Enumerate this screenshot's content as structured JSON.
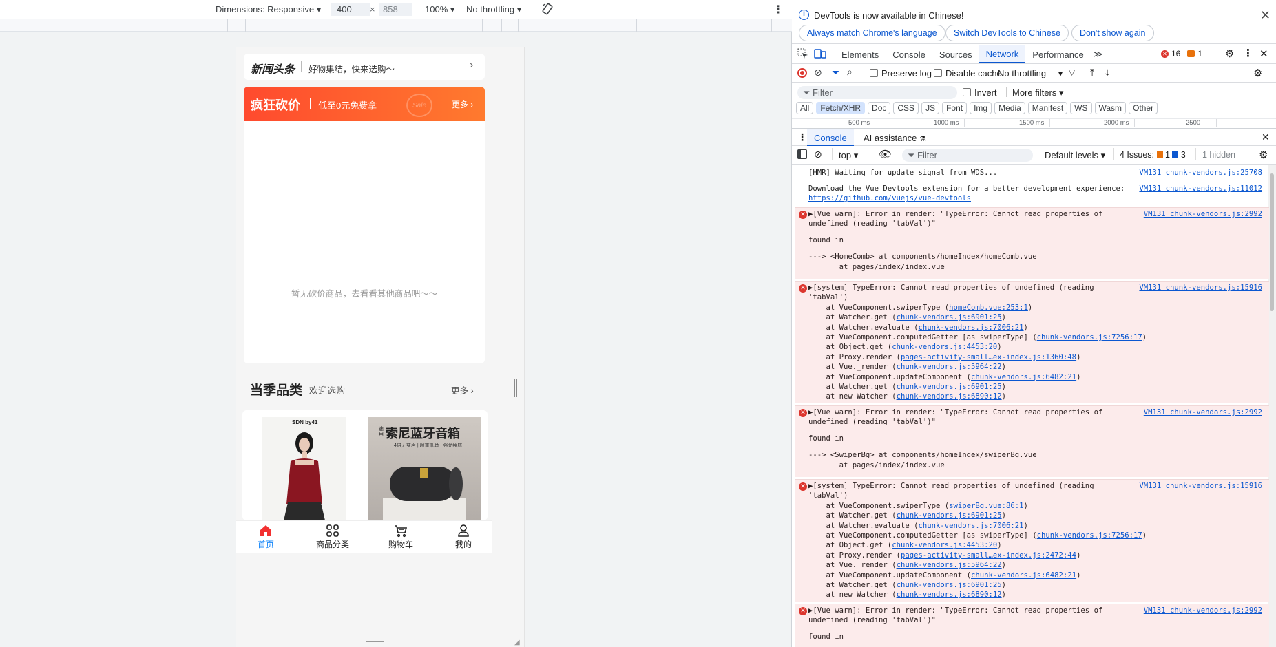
{
  "devtoolbar": {
    "dimensions": "Dimensions: Responsive",
    "width": "400",
    "height": "858",
    "zoom": "100%",
    "throttling": "No throttling"
  },
  "phone": {
    "brand": "新闻头条",
    "brand_sub": "好物集结，快来选购～",
    "bargain_title": "疯狂砍价",
    "bargain_sub": "低至0元免费拿",
    "bargain_more": "更多",
    "empty_text": "暂无砍价商品，去看看其他商品吧～～",
    "season_title": "当季品类",
    "season_sub": "欢迎选购",
    "season_more": "更多",
    "product1_label": "SDN by41",
    "product2_title": "索尼蓝牙音箱",
    "product2_badge": "速用",
    "product2_sub": "4倍无变声 | 超重低音 | 强劲续航",
    "tabbar": [
      {
        "label": "首页",
        "icon": "home-icon",
        "active": true
      },
      {
        "label": "商品分类",
        "icon": "grid-icon",
        "active": false
      },
      {
        "label": "购物车",
        "icon": "cart-icon",
        "active": false
      },
      {
        "label": "我的",
        "icon": "user-icon",
        "active": false
      }
    ]
  },
  "devtools": {
    "banner": "DevTools is now available in Chinese!",
    "btn_match": "Always match Chrome's language",
    "btn_switch": "Switch DevTools to Chinese",
    "btn_dont": "Don't show again",
    "tabs": [
      "Elements",
      "Console",
      "Sources",
      "Network",
      "Performance"
    ],
    "active_tab": "Network",
    "error_count": "16",
    "warn_count": "1",
    "preserve_log": "Preserve log",
    "disable_cache": "Disable cache",
    "net_throttling": "No throttling",
    "filter_placeholder": "Filter",
    "invert": "Invert",
    "more_filters": "More filters",
    "filter_chips": [
      "All",
      "Fetch/XHR",
      "Doc",
      "CSS",
      "JS",
      "Font",
      "Img",
      "Media",
      "Manifest",
      "WS",
      "Wasm",
      "Other"
    ],
    "timeline": [
      "500 ms",
      "1000 ms",
      "1500 ms",
      "2000 ms",
      "2500"
    ],
    "drawer_tabs": [
      "Console",
      "AI assistance"
    ],
    "context": "top",
    "console_filter": "Filter",
    "levels": "Default levels",
    "issues": "4 Issues:",
    "issues_warn": "1",
    "issues_info": "3",
    "hidden": "1 hidden"
  },
  "console": {
    "m1": "[HMR] Waiting for update signal from WDS...",
    "m1_src": "VM131 chunk-vendors.js:25708",
    "m2a": "Download the Vue Devtools extension for a better development experience:",
    "m2b": "https://github.com/vuejs/vue-devtools",
    "m2_src": "VM131 chunk-vendors.js:11012",
    "e1a": "▶[Vue warn]: Error in render: \"TypeError: Cannot read properties of",
    "e1b": "undefined (reading 'tabVal')\"",
    "e1c": "found in",
    "e1d": "---> <HomeComb> at components/homeIndex/homeComb.vue",
    "e1e": "       at pages/index/index.vue",
    "e1_src": "VM131 chunk-vendors.js:2992",
    "e2a": "▶[system] TypeError: Cannot read properties of undefined (reading",
    "e2b": "'tabVal')",
    "e2_src": "VM131 chunk-vendors.js:15916",
    "e2_stack": [
      {
        "t": "    at VueComponent.swiperType (",
        "l": "homeComb.vue:253:1"
      },
      {
        "t": "    at Watcher.get (",
        "l": "chunk-vendors.js:6901:25"
      },
      {
        "t": "    at Watcher.evaluate (",
        "l": "chunk-vendors.js:7006:21"
      },
      {
        "t": "    at VueComponent.computedGetter [as swiperType] (",
        "l": "chunk-vendors.js:7256:17"
      },
      {
        "t": "    at Object.get (",
        "l": "chunk-vendors.js:4453:20"
      },
      {
        "t": "    at Proxy.render (",
        "l": "pages-activity-small…ex-index.js:1360:48"
      },
      {
        "t": "    at Vue._render (",
        "l": "chunk-vendors.js:5964:22"
      },
      {
        "t": "    at VueComponent.updateComponent (",
        "l": "chunk-vendors.js:6482:21"
      },
      {
        "t": "    at Watcher.get (",
        "l": "chunk-vendors.js:6901:25"
      },
      {
        "t": "    at new Watcher (",
        "l": "chunk-vendors.js:6890:12"
      }
    ],
    "e3a": "▶[Vue warn]: Error in render: \"TypeError: Cannot read properties of",
    "e3b": "undefined (reading 'tabVal')\"",
    "e3c": "found in",
    "e3d": "---> <SwiperBg> at components/homeIndex/swiperBg.vue",
    "e3e": "       at pages/index/index.vue",
    "e3_src": "VM131 chunk-vendors.js:2992",
    "e4a": "▶[system] TypeError: Cannot read properties of undefined (reading",
    "e4b": "'tabVal')",
    "e4_src": "VM131 chunk-vendors.js:15916",
    "e4_stack": [
      {
        "t": "    at VueComponent.swiperType (",
        "l": "swiperBg.vue:86:1"
      },
      {
        "t": "    at Watcher.get (",
        "l": "chunk-vendors.js:6901:25"
      },
      {
        "t": "    at Watcher.evaluate (",
        "l": "chunk-vendors.js:7006:21"
      },
      {
        "t": "    at VueComponent.computedGetter [as swiperType] (",
        "l": "chunk-vendors.js:7256:17"
      },
      {
        "t": "    at Object.get (",
        "l": "chunk-vendors.js:4453:20"
      },
      {
        "t": "    at Proxy.render (",
        "l": "pages-activity-small…ex-index.js:2472:44"
      },
      {
        "t": "    at Vue._render (",
        "l": "chunk-vendors.js:5964:22"
      },
      {
        "t": "    at VueComponent.updateComponent (",
        "l": "chunk-vendors.js:6482:21"
      },
      {
        "t": "    at Watcher.get (",
        "l": "chunk-vendors.js:6901:25"
      },
      {
        "t": "    at new Watcher (",
        "l": "chunk-vendors.js:6890:12"
      }
    ],
    "e5a": "▶[Vue warn]: Error in render: \"TypeError: Cannot read properties of",
    "e5b": "undefined (reading 'tabVal')\"",
    "e5c": "found in",
    "e5_src": "VM131 chunk-vendors.js:2992"
  },
  "colors": {
    "accent": "#0b57d0",
    "error": "#dc362e",
    "error_bg": "#fcebeb",
    "brand_red": "#ff4a2e",
    "tab_active": "#1989fa",
    "home_red": "#f23030"
  }
}
